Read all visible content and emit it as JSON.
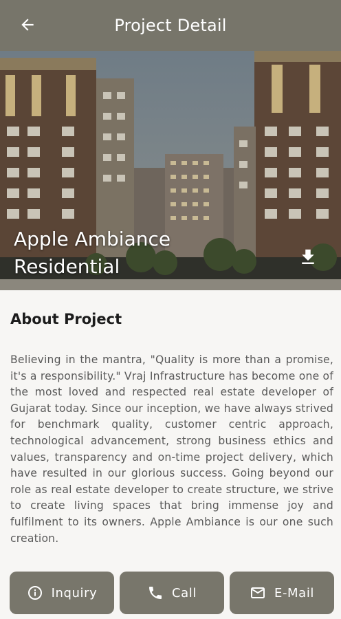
{
  "appbar": {
    "title": "Project Detail",
    "back_icon": "arrow-left-icon",
    "color": "#77756a"
  },
  "hero": {
    "title_line1": "Apple Ambiance",
    "title_line2": "Residential",
    "download_icon": "download-icon"
  },
  "about": {
    "heading": "About Project",
    "body": "Believing in the mantra, \"Quality is more than a promise, it's a responsibility.\" Vraj Infrastructure has become one of the most loved and respected real estate developer of Gujarat today. Since our inception, we have always strived for benchmark quality, customer centric approach, technological advancement, strong business ethics and values, transparency and on-time project delivery, which have resulted in our glorious success. Going beyond our role as real estate developer to create structure, we strive to create living spaces that bring immense joy and fulfilment to its owners. Apple Ambiance is our one such creation."
  },
  "actions": {
    "inquiry_label": "Inquiry",
    "inquiry_icon": "info-icon",
    "call_label": "Call",
    "call_icon": "phone-icon",
    "email_label": "E-Mail",
    "email_icon": "mail-icon",
    "button_color": "#78766b"
  }
}
